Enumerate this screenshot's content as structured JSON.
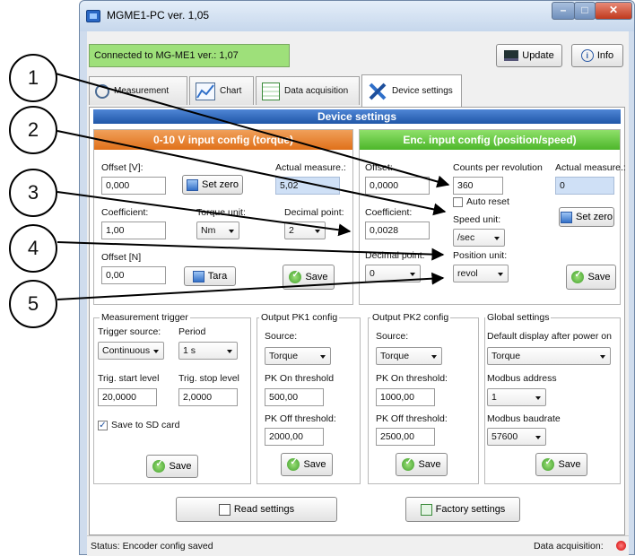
{
  "window": {
    "title": "MGME1-PC ver. 1,05"
  },
  "header": {
    "connection_status": "Connected to MG-ME1 ver.: 1,07",
    "update_label": "Update",
    "info_label": "Info"
  },
  "tabs": [
    {
      "label": "Measurement"
    },
    {
      "label": "Chart"
    },
    {
      "label": "Data acquisition"
    },
    {
      "label": "Device settings"
    }
  ],
  "device_settings": {
    "title": "Device settings",
    "input_config": {
      "header": "0-10 V input config (torque)",
      "offset_label": "Offset [V]:",
      "offset_value": "0,000",
      "set_zero_label": "Set zero",
      "actual_label": "Actual measure.:",
      "actual_value": "5,02",
      "coefficient_label": "Coefficient:",
      "coefficient_value": "1,00",
      "torque_unit_label": "Torque unit:",
      "torque_unit_value": "Nm",
      "decimal_point_label": "Decimal point:",
      "decimal_point_value": "2",
      "offset_n_label": "Offset  [N]",
      "offset_n_value": "0,00",
      "tara_label": "Tara",
      "save_label": "Save"
    },
    "enc_config": {
      "header": "Enc. input config (position/speed)",
      "offset_label": "Offset:",
      "offset_value": "0,0000",
      "counts_label": "Counts per revolution",
      "counts_value": "360",
      "auto_reset_label": "Auto reset",
      "actual_label": "Actual measure.:",
      "actual_value": "0",
      "coefficient_label": "Coefficient:",
      "coefficient_value": "0,0028",
      "speed_unit_label": "Speed unit:",
      "speed_unit_value": "/sec",
      "set_zero_label": "Set zero",
      "decimal_point_label": "Decimal point:",
      "decimal_point_value": "0",
      "position_unit_label": "Position unit:",
      "position_unit_value": "revol",
      "save_label": "Save"
    },
    "trigger": {
      "title": "Measurement trigger",
      "source_label": "Trigger source:",
      "source_value": "Continuous",
      "period_label": "Period",
      "period_value": "1 s",
      "start_label": "Trig. start level",
      "start_value": "20,0000",
      "stop_label": "Trig. stop level",
      "stop_value": "2,0000",
      "sd_label": "Save to SD card",
      "save_label": "Save"
    },
    "pk1": {
      "title": "Output PK1 config",
      "source_label": "Source:",
      "source_value": "Torque",
      "on_label": "PK On threshold",
      "on_value": "500,00",
      "off_label": "PK Off threshold:",
      "off_value": "2000,00",
      "save_label": "Save"
    },
    "pk2": {
      "title": "Output PK2 config",
      "source_label": "Source:",
      "source_value": "Torque",
      "on_label": "PK On threshold:",
      "on_value": "1000,00",
      "off_label": "PK Off threshold:",
      "off_value": "2500,00",
      "save_label": "Save"
    },
    "global": {
      "title": "Global settings",
      "display_label": "Default display after power on",
      "display_value": "Torque",
      "modbus_addr_label": "Modbus address",
      "modbus_addr_value": "1",
      "baud_label": "Modbus baudrate",
      "baud_value": "57600",
      "save_label": "Save"
    },
    "read_settings_label": "Read settings",
    "factory_settings_label": "Factory settings"
  },
  "status": {
    "text": "Status:   Encoder config saved",
    "data_acq_label": "Data acquisition:",
    "indicator_color": "#e01010"
  },
  "callouts": [
    "1",
    "2",
    "3",
    "4",
    "5"
  ]
}
